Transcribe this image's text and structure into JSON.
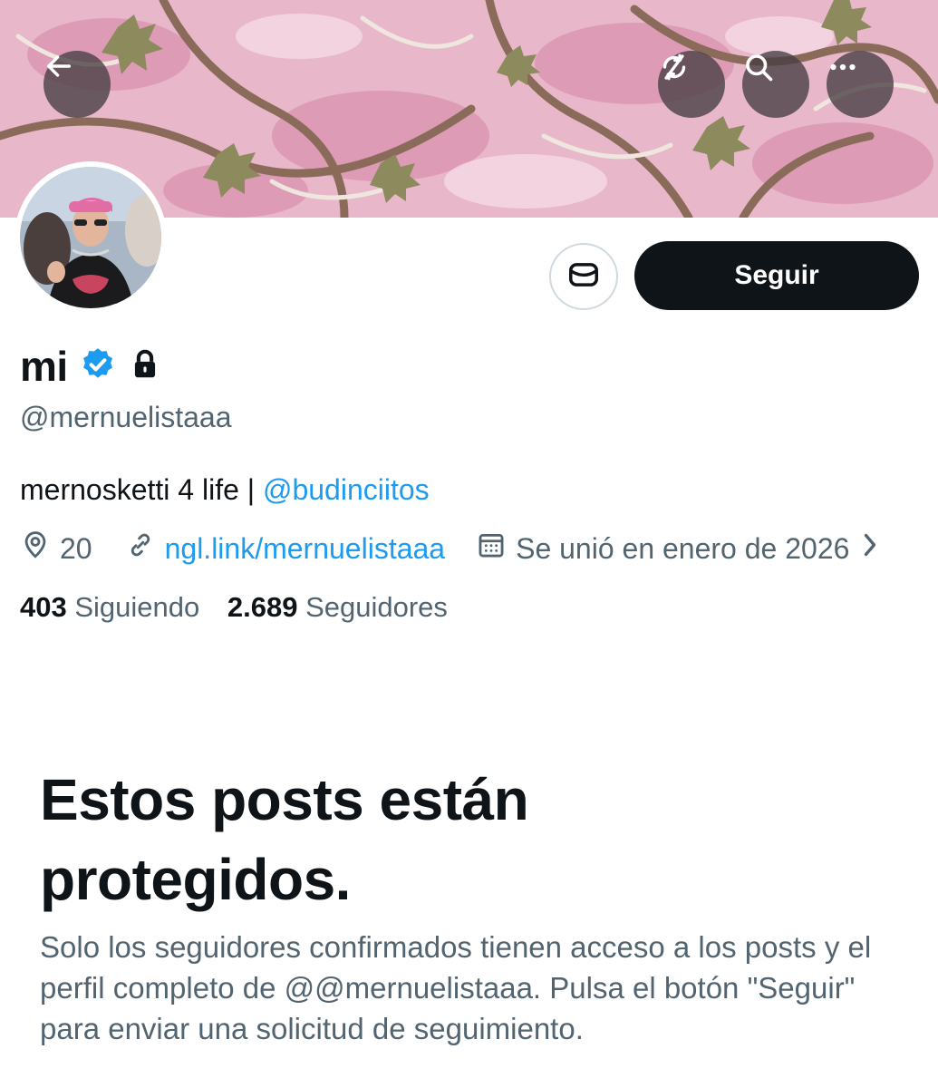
{
  "colors": {
    "banner_pink": "#e9b9cb",
    "primary_text": "#0f1419",
    "secondary_text": "#536471",
    "link_blue": "#1d9bf0",
    "verified_blue": "#1d9bf0"
  },
  "header": {
    "back_icon": "back-arrow-icon",
    "sync_icon": "sync-off-icon",
    "search_icon": "search-icon",
    "more_icon": "more-icon"
  },
  "profile": {
    "display_name": "mi",
    "handle": "@mernuelistaaa",
    "bio_text": "mernosketti 4 life | ",
    "bio_mention": "@budinciitos",
    "location": "20",
    "website": "ngl.link/mernuelistaaa",
    "joined": "Se unió en enero de 2026",
    "following_count": "403",
    "following_label": "Siguiendo",
    "followers_count": "2.689",
    "followers_label": "Seguidores"
  },
  "actions": {
    "follow_label": "Seguir",
    "message_icon": "message-icon"
  },
  "protected": {
    "title": "Estos posts están protegidos.",
    "description": "Solo los seguidores confirmados tienen acceso a los posts y el perfil completo de @@mernuelistaaa. Pulsa el botón \"Seguir\" para enviar una solicitud de seguimiento."
  }
}
